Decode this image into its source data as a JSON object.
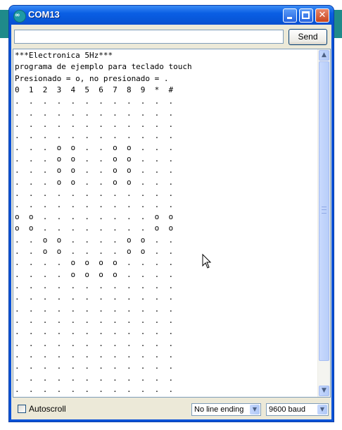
{
  "window": {
    "title": "COM13"
  },
  "send": {
    "input_value": "",
    "button_label": "Send"
  },
  "output": {
    "lines": [
      "***Electronica 5Hz***",
      "programa de ejemplo para teclado touch",
      "Presionado = o, no presionado = .",
      "0  1  2  3  4  5  6  7  8  9  *  #",
      ".  .  .  .  .  .  .  .  .  .  .  .",
      ".  .  .  .  .  .  .  .  .  .  .  .",
      ".  .  .  .  .  .  .  .  .  .  .  .",
      ".  .  .  .  .  .  .  .  .  .  .  .",
      ".  .  .  o  o  .  .  o  o  .  .  .",
      ".  .  .  o  o  .  .  o  o  .  .  .",
      ".  .  .  o  o  .  .  o  o  .  .  .",
      ".  .  .  o  o  .  .  o  o  .  .  .",
      ".  .  .  .  .  .  .  .  .  .  .  .",
      ".  .  .  .  .  .  .  .  .  .  .  .",
      "o  o  .  .  .  .  .  .  .  .  o  o",
      "o  o  .  .  .  .  .  .  .  .  o  o",
      ".  .  o  o  .  .  .  .  o  o  .  .",
      ".  .  o  o  .  .  .  .  o  o  .  .",
      ".  .  .  .  o  o  o  o  .  .  .  .",
      ".  .  .  .  o  o  o  o  .  .  .  .",
      ".  .  .  .  .  .  .  .  .  .  .  .",
      ".  .  .  .  .  .  .  .  .  .  .  .",
      ".  .  .  .  .  .  .  .  .  .  .  .",
      ".  .  .  .  .  .  .  .  .  .  .  .",
      ".  .  .  .  .  .  .  .  .  .  .  .",
      ".  .  .  .  .  .  .  .  .  .  .  .",
      ".  .  .  .  .  .  .  .  .  .  .  .",
      ".  .  .  .  .  .  .  .  .  .  .  .",
      ".  .  .  .  .  .  .  .  .  .  .  .",
      ".  .  .  .  .  .  .  .  .  .  .  ."
    ]
  },
  "bottom": {
    "autoscroll_label": "Autoscroll",
    "autoscroll_checked": false,
    "line_ending": "No line ending",
    "baud": "9600 baud"
  },
  "icons": {
    "app": "arduino-icon",
    "minimize": "minimize-icon",
    "maximize": "maximize-icon",
    "close": "close-icon",
    "dropdown": "chevron-down-icon",
    "cursor": "mouse-pointer-icon"
  },
  "colors": {
    "titlebar": "#0a5ee4",
    "client": "#ece9d8",
    "accent": "#1e9aa6"
  }
}
